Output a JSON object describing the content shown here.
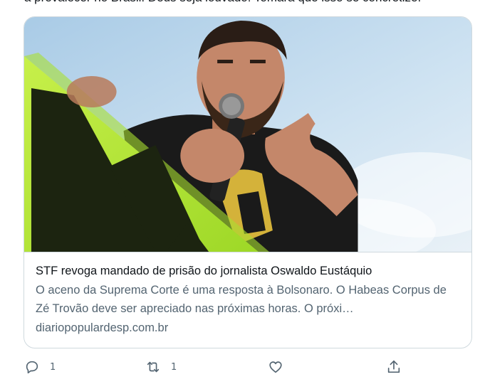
{
  "tweet": {
    "cut_text": "a prevalecer no Brasil. Deus seja louvado! Tomara que isso se concretize."
  },
  "card": {
    "image_alt": "Man with beard speaking into a microphone and pointing, green banner in foreground",
    "title": "STF revoga mandado de prisão do jornalista Oswaldo Eustáquio",
    "description": "O aceno da Suprema Corte é uma resposta à Bolsonaro. O Habeas Corpus de Zé Trovão deve ser apreciado nas próximas horas. O próxi…",
    "domain": "diariopopulardesp.com.br"
  },
  "actions": {
    "reply": {
      "icon": "reply-icon",
      "count": "1"
    },
    "retweet": {
      "icon": "retweet-icon",
      "count": "1"
    },
    "like": {
      "icon": "heart-icon",
      "count": ""
    },
    "share": {
      "icon": "share-icon"
    }
  },
  "colors": {
    "text_primary": "#0f1419",
    "text_secondary": "#536471",
    "border": "#cfd9de",
    "banner_green": "#b6f03a",
    "sky": "#cde3f2"
  }
}
